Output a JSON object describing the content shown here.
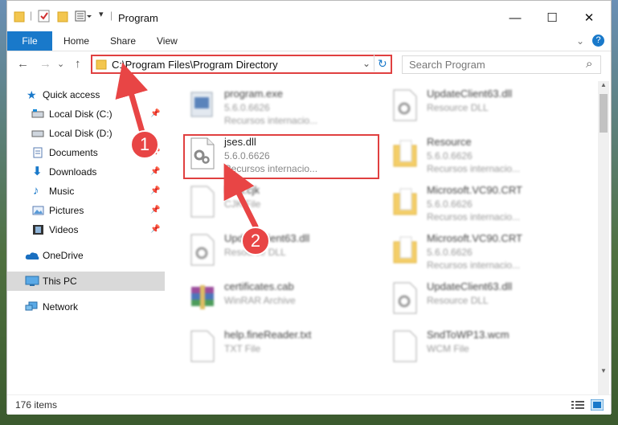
{
  "window": {
    "title": "Program",
    "minimize": "—",
    "maximize": "☐",
    "close": "✕"
  },
  "ribbon": {
    "file": "File",
    "home": "Home",
    "share": "Share",
    "view": "View",
    "collapse": "⌄",
    "help": "?"
  },
  "nav": {
    "back": "←",
    "forward": "→",
    "recent": "⌄",
    "up": "↑",
    "address": "C:\\Program Files\\Program Directory",
    "address_dropdown": "⌄",
    "refresh": "↻",
    "search_placeholder": "Search Program",
    "search_icon": "⌕"
  },
  "sidebar": {
    "items": [
      {
        "label": "Quick access",
        "icon": "star-icon"
      },
      {
        "label": "Local Disk (C:)",
        "icon": "drive-icon",
        "pinned": true
      },
      {
        "label": "Local Disk (D:)",
        "icon": "drive-icon",
        "pinned": false
      },
      {
        "label": "Documents",
        "icon": "documents-icon",
        "pinned": true
      },
      {
        "label": "Downloads",
        "icon": "download-icon",
        "pinned": true
      },
      {
        "label": "Music",
        "icon": "music-icon",
        "pinned": true
      },
      {
        "label": "Pictures",
        "icon": "pictures-icon",
        "pinned": true
      },
      {
        "label": "Videos",
        "icon": "videos-icon",
        "pinned": true
      },
      {
        "label": "OneDrive",
        "icon": "cloud-icon"
      },
      {
        "label": "This PC",
        "icon": "computer-icon",
        "selected": true
      },
      {
        "label": "Network",
        "icon": "network-icon"
      }
    ]
  },
  "files": [
    {
      "name": "program.exe",
      "l2": "5.6.0.6626",
      "l3": "Recursos internacio..."
    },
    {
      "name": "UpdateClient63.dll",
      "l2": "Resource DLL",
      "l3": ""
    },
    {
      "name": "jses.dll",
      "l2": "5.6.0.6626",
      "l3": "Recursos internacio..."
    },
    {
      "name": "Resource",
      "l2": "5.6.0.6626",
      "l3": "Recursos internacio..."
    },
    {
      "name": "html.cjk",
      "l2": "CJK File",
      "l3": ""
    },
    {
      "name": "Microsoft.VC90.CRT",
      "l2": "5.6.0.6626",
      "l3": "Recursos internacio..."
    },
    {
      "name": "UpdateClient63.dll",
      "l2": "Resource DLL",
      "l3": ""
    },
    {
      "name": "Microsoft.VC90.CRT",
      "l2": "5.6.0.6626",
      "l3": "Recursos internacio..."
    },
    {
      "name": "certificates.cab",
      "l2": "WinRAR Archive",
      "l3": ""
    },
    {
      "name": "UpdateClient63.dll",
      "l2": "Resource DLL",
      "l3": ""
    },
    {
      "name": "help.fineReader.txt",
      "l2": "TXT File",
      "l3": ""
    },
    {
      "name": "SndToWP13.wcm",
      "l2": "WCM File",
      "l3": ""
    }
  ],
  "status": {
    "count": "176 items"
  },
  "callouts": {
    "one": "1",
    "two": "2"
  },
  "colors": {
    "accent": "#1979ca",
    "highlight": "#e04040",
    "callout": "#e84545"
  }
}
